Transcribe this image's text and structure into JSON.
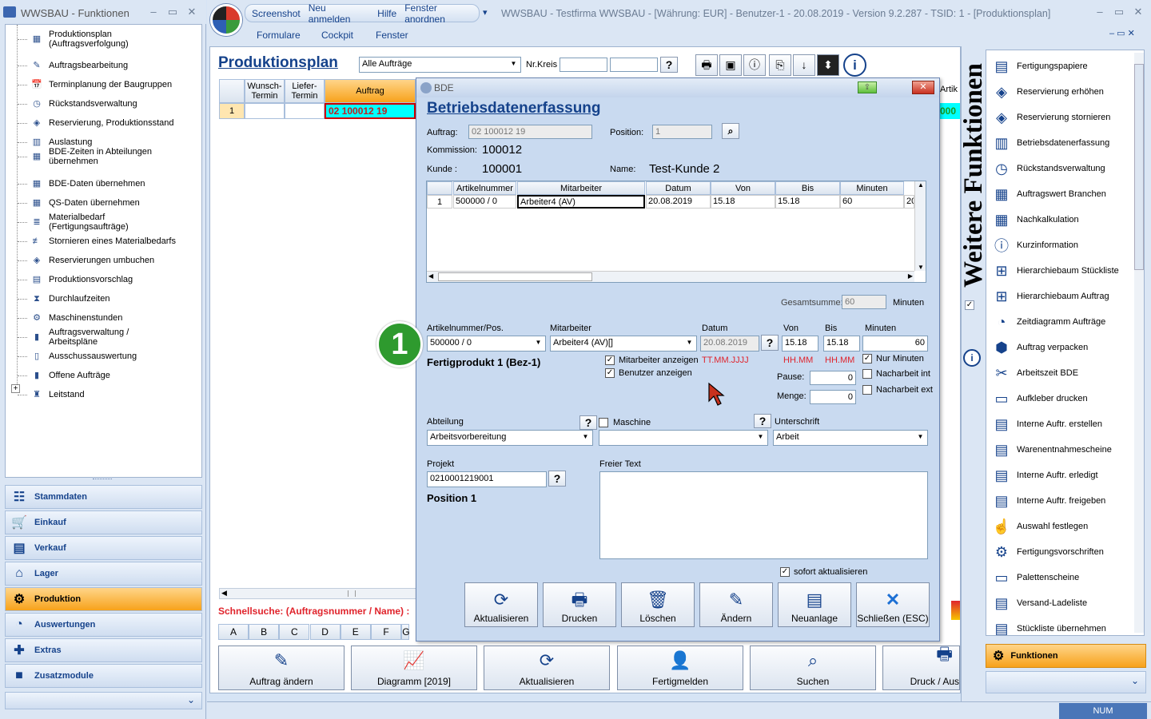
{
  "left_window": {
    "title": "WWSBAU - Funktionen"
  },
  "tree": [
    {
      "label": "Produktionsplan (Auftragsverfolgung)",
      "icon": "production-plan-icon"
    },
    {
      "label": "Auftragsbearbeitung",
      "icon": "document-edit-icon"
    },
    {
      "label": "Terminplanung der Baugruppen",
      "icon": "calendar-icon"
    },
    {
      "label": "Rückstandsverwaltung",
      "icon": "clock-icon"
    },
    {
      "label": "Reservierung, Produktionsstand",
      "icon": "cube-icon"
    },
    {
      "label": "Auslastung",
      "icon": "chart-icon"
    },
    {
      "label": "BDE-Zeiten in Abteilungen übernehmen",
      "icon": "calculator-icon"
    },
    {
      "label": "BDE-Daten übernehmen",
      "icon": "calculator-icon"
    },
    {
      "label": "QS-Daten übernehmen",
      "icon": "calculator-icon"
    },
    {
      "label": "Materialbedarf (Fertigungsaufträge)",
      "icon": "stack-icon"
    },
    {
      "label": "Stornieren eines Materialbedarfs",
      "icon": "stack-cancel-icon"
    },
    {
      "label": "Reservierungen umbuchen",
      "icon": "cube-icon"
    },
    {
      "label": "Produktionsvorschlag",
      "icon": "document-icon"
    },
    {
      "label": "Durchlaufzeiten",
      "icon": "hourglass-icon"
    },
    {
      "label": "Maschinenstunden",
      "icon": "machine-icon"
    },
    {
      "label": "Auftragsverwaltung / Arbeitspläne",
      "icon": "book-icon"
    },
    {
      "label": "Ausschussauswertung",
      "icon": "bin-icon"
    },
    {
      "label": "Offene Aufträge",
      "icon": "book-icon"
    },
    {
      "label": "Leitstand",
      "icon": "control-icon"
    }
  ],
  "tree_expander": "+",
  "nav": [
    {
      "label": "Stammdaten",
      "icon": "☷"
    },
    {
      "label": "Einkauf",
      "icon": "🛒"
    },
    {
      "label": "Verkauf",
      "icon": "▤"
    },
    {
      "label": "Lager",
      "icon": "⌂"
    },
    {
      "label": "Produktion",
      "icon": "⚙"
    },
    {
      "label": "Auswertungen",
      "icon": "◔"
    },
    {
      "label": "Extras",
      "icon": "✚"
    },
    {
      "label": "Zusatzmodule",
      "icon": "■"
    }
  ],
  "nav_more": "⌄",
  "menu": {
    "screenshot": "Screenshot",
    "neu_anmelden": "Neu anmelden",
    "hilfe": "Hilfe",
    "fenster_anordnen": "Fenster anordnen",
    "dropdown": "▾"
  },
  "main_title": "WWSBAU - Testfirma WWSBAU - [Währung: EUR] - Benutzer-1 - 20.08.2019 - Version 9.2.287 - TSID: 1  - [Produktionsplan]",
  "submenu": {
    "formulare": "Formulare",
    "cockpit": "Cockpit",
    "fenster": "Fenster"
  },
  "prod": {
    "title": "Produktionsplan",
    "filter": "Alle Aufträge",
    "nrkreis_label": "Nr.Kreis",
    "nrkreis_from": "",
    "nrkreis_to": "",
    "help": "?"
  },
  "grid": {
    "headers": [
      "Wunsch-\nTermin",
      "Liefer-\nTermin",
      "Auftrag"
    ],
    "row_num": "1",
    "auftrag": "02 100012 19",
    "right_header": "Artik",
    "right_cell": "000"
  },
  "schnellsuche": "Schnellsuche: (Auftragsnummer / Name) :",
  "alphabet": [
    "A",
    "B",
    "C",
    "D",
    "E",
    "F",
    "G"
  ],
  "bottom_buttons": [
    "Auftrag ändern",
    "Diagramm [2019]",
    "Aktualisieren",
    "Fertigmelden",
    "Suchen",
    "Druck / Aus"
  ],
  "bde": {
    "window_title": "BDE",
    "title": "Betriebsdatenerfassung",
    "auftrag_label": "Auftrag:",
    "auftrag": "02 100012 19",
    "position_label": "Position:",
    "position": "1",
    "kommission_label": "Kommission:",
    "kommission": "100012",
    "kunde_label": "Kunde :",
    "kunde": "100001",
    "name_label": "Name:",
    "name": "Test-Kunde 2",
    "table": {
      "headers": [
        "Artikelnummer",
        "Mitarbeiter",
        "Datum",
        "Von",
        "Bis",
        "Minuten"
      ],
      "rows": [
        {
          "n": "1",
          "artikel": "500000 / 0",
          "mitarbeiter": "Arbeiter4 (AV)",
          "datum": "20.08.2019",
          "von": "15.18",
          "bis": "15.18",
          "minuten": "60",
          "extra": "20"
        }
      ]
    },
    "gesamtsumme_label": "Gesamtsumme:",
    "gesamtsumme": "60",
    "minuten_label": "Minuten",
    "artpos_label": "Artikelnummer/Pos.",
    "artpos": "500000 / 0",
    "mitarbeiter_label": "Mitarbeiter",
    "mitarbeiter": "Arbeiter4 (AV)[]",
    "datum_label": "Datum",
    "datum": "20.08.2019",
    "von_label": "Von",
    "von": "15.18",
    "bis_label": "Bis",
    "bis": "15.18",
    "minuten_field_label": "Minuten",
    "minuten": "60",
    "fertigprodukt": "Fertigprodukt 1  (Bez-1)",
    "mitarbeiter_anzeigen": "Mitarbeiter anzeigen",
    "benutzer_anzeigen": "Benutzer anzeigen",
    "datum_hint": "TT.MM.JJJJ",
    "von_hint": "HH.MM",
    "bis_hint": "HH.MM",
    "nur_minuten": "Nur Minuten",
    "nacharbeit_int": "Nacharbeit int",
    "nacharbeit_ext": "Nacharbeit ext",
    "pause_label": "Pause:",
    "pause": "0",
    "menge_label": "Menge:",
    "menge": "0",
    "abteilung_label": "Abteilung",
    "abteilung": "Arbeitsvorbereitung",
    "maschine_label": "Maschine",
    "maschine": "",
    "unterschrift_label": "Unterschrift",
    "unterschrift": "Arbeit",
    "projekt_label": "Projekt",
    "projekt": "0210001219001",
    "position_text": "Position 1",
    "freier_text_label": "Freier Text",
    "freier_text": "",
    "sofort": "sofort aktualisieren",
    "buttons": [
      "Aktualisieren",
      "Drucken",
      "Löschen",
      "Ändern",
      "Neuanlage",
      "Schließen (ESC)"
    ],
    "checked": "✓"
  },
  "callout_number": "1",
  "right": {
    "vertical_title": "Weitere Funktionen",
    "items": [
      "Fertigungspapiere",
      "Reservierung erhöhen",
      "Reservierung stornieren",
      "Betriebsdatenerfassung",
      "Rückstandsverwaltung",
      "Auftragswert Branchen",
      "Nachkalkulation",
      "Kurzinformation",
      "Hierarchiebaum Stückliste",
      "Hierarchiebaum Auftrag",
      "Zeitdiagramm Aufträge",
      "Auftrag verpacken",
      "Arbeitszeit BDE",
      "Aufkleber drucken",
      "Interne Auftr. erstellen",
      "Warenentnahmescheine",
      "Interne Auftr. erledigt",
      "Interne Auftr. freigeben",
      "Auswahl festlegen",
      "Fertigungsvorschriften",
      "Palettenscheine",
      "Versand-Ladeliste",
      "Stückliste übernehmen"
    ],
    "footer": "Funktionen"
  },
  "status": {
    "num": "NUM"
  },
  "colors": {
    "accent": "#15428b",
    "active_nav": "#f7a21b",
    "grid_highlight": "#00ffff",
    "callout": "#2e9a2e"
  }
}
